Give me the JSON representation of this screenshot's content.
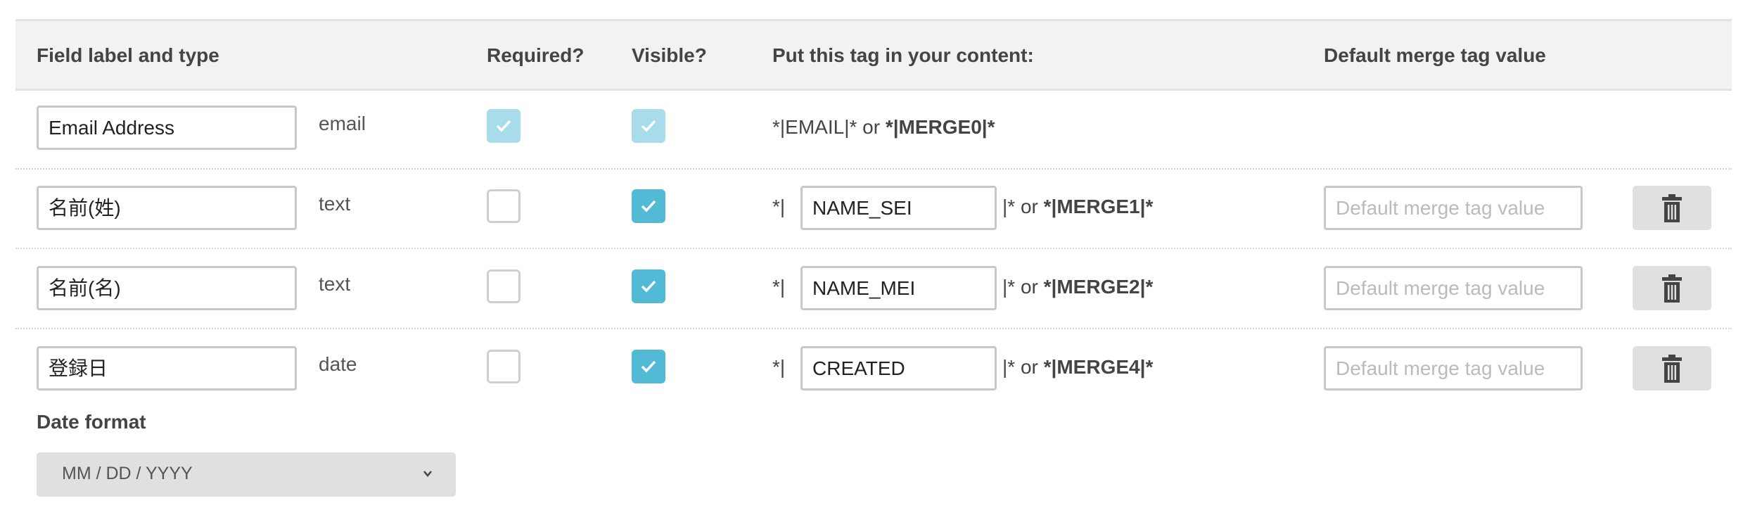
{
  "header": {
    "field_label": "Field label and type",
    "required": "Required?",
    "visible": "Visible?",
    "tag": "Put this tag in your content:",
    "default": "Default merge tag value"
  },
  "colors": {
    "checked": "#52bad5",
    "checked_disabled": "#a9dcea",
    "header_bg": "#f2f2f2"
  },
  "rows": [
    {
      "label": "Email Address",
      "type": "email",
      "required": true,
      "visible": true,
      "locked": true,
      "tag_prefix": "*|EMAIL|* or ",
      "merge": "*|MERGE0|*"
    },
    {
      "label": "名前(姓)",
      "type": "text",
      "required": false,
      "visible": true,
      "locked": false,
      "tag_open": "*|",
      "tag": "NAME_SEI",
      "tag_close": "|* or ",
      "merge": "*|MERGE1|*",
      "default_placeholder": "Default merge tag value",
      "delete_icon": "trash-icon"
    },
    {
      "label": "名前(名)",
      "type": "text",
      "required": false,
      "visible": true,
      "locked": false,
      "tag_open": "*|",
      "tag": "NAME_MEI",
      "tag_close": "|* or ",
      "merge": "*|MERGE2|*",
      "default_placeholder": "Default merge tag value",
      "delete_icon": "trash-icon"
    },
    {
      "label": "登録日",
      "type": "date",
      "required": false,
      "visible": true,
      "locked": false,
      "tag_open": "*|",
      "tag": "CREATED",
      "tag_close": "|* or ",
      "merge": "*|MERGE4|*",
      "default_placeholder": "Default merge tag value",
      "delete_icon": "trash-icon"
    }
  ],
  "date_format": {
    "label": "Date format",
    "value": "MM / DD / YYYY"
  }
}
